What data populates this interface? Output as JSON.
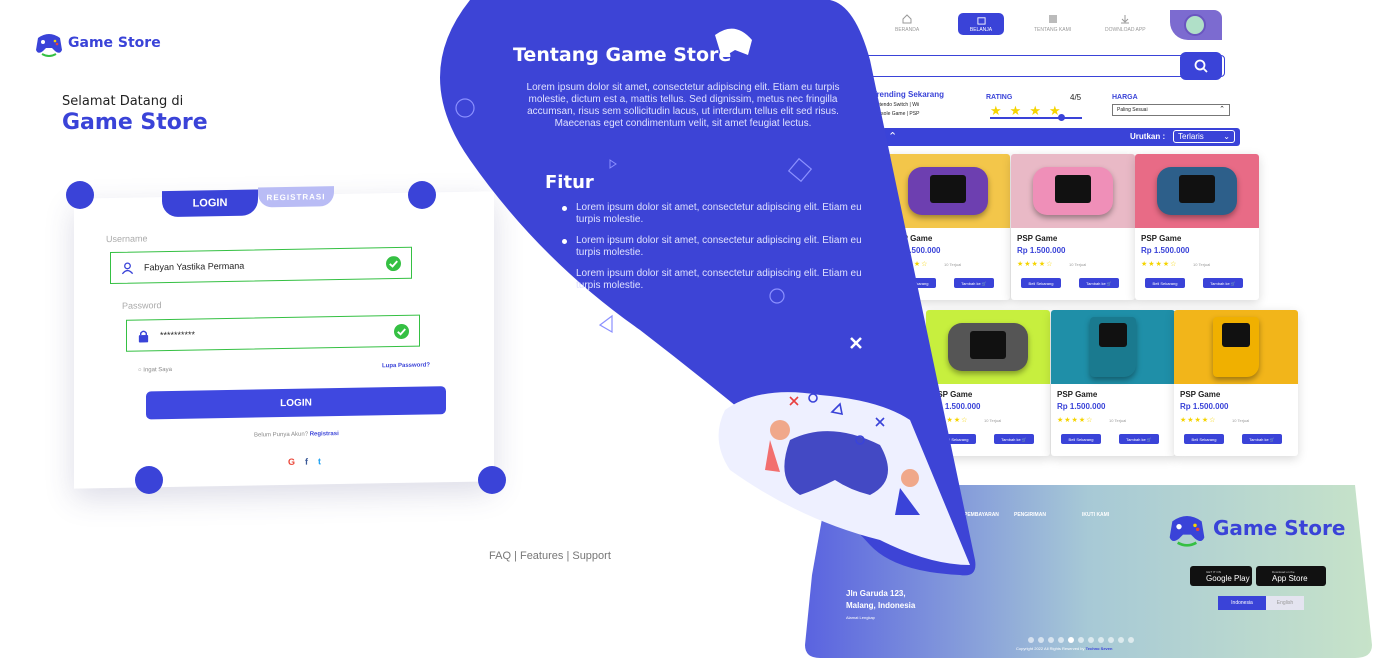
{
  "brand": "Game Store",
  "login": {
    "welcome": "Selamat Datang di",
    "welcome_brand": "Game Store",
    "tab_login": "LOGIN",
    "tab_register": "REGISTRASI",
    "username_label": "Username",
    "username_value": "Fabyan Yastika Permana",
    "password_label": "Password",
    "password_value": "**********",
    "remember": "Ingat Saya",
    "forgot": "Lupa Password?",
    "login_button": "LOGIN",
    "no_account": "Belum Punya Akun?",
    "register_link": "Registrasi",
    "social": [
      "G",
      "f",
      "t"
    ],
    "footer_links": "FAQ | Features | Support"
  },
  "about": {
    "title": "Tentang Game Store",
    "text": "Lorem ipsum dolor sit amet, consectetur adipiscing elit. Etiam eu turpis molestie, dictum est a, mattis tellus. Sed dignissim, metus nec fringilla accumsan, risus sem sollicitudin lacus, ut interdum tellus elit sed risus. Maecenas eget condimentum velit, sit amet feugiat lectus.",
    "features_title": "Fitur",
    "features": [
      "Lorem ipsum dolor sit amet, consectetur adipiscing elit. Etiam eu turpis molestie.",
      "Lorem ipsum dolor sit amet, consectetur adipiscing elit. Etiam eu turpis molestie.",
      "Lorem ipsum dolor sit amet, consectetur adipiscing elit. Etiam eu turpis molestie."
    ]
  },
  "shop": {
    "nav": [
      "BERANDA",
      "BELANJA",
      "TENTANG KAMI",
      "DOWNLOAD APP"
    ],
    "trending_title": "Trending Sekarang",
    "trending_items": [
      "Nintendo Switch | Wii",
      "Console Game | PSP"
    ],
    "rating_label": "RATING",
    "rating_value": "4/5",
    "rating_fraction": 0.8,
    "harga_label": "HARGA",
    "harga_value": "Paling Sesuai",
    "sort_label": "Urutkan :",
    "sort_value": "Terlaris",
    "products": [
      {
        "name": "PSP Game",
        "price": "Rp 1.500.000",
        "sold": "10 Terjual",
        "bg": "#f3c64a",
        "body": "#6d3fb0",
        "kind": "gba"
      },
      {
        "name": "PSP Game",
        "price": "Rp 1.500.000",
        "sold": "10 Terjual",
        "bg": "#e9b9c6",
        "body": "#ef8fb8",
        "kind": "psp"
      },
      {
        "name": "PSP Game",
        "price": "Rp 1.500.000",
        "sold": "10 Terjual",
        "bg": "#e86b86",
        "body": "#2d5f8a",
        "kind": "gba"
      },
      {
        "name": "PSP Game",
        "price": "Rp 1.500.000",
        "sold": "10 Terjual",
        "bg": "#c7ef3e",
        "body": "#555555",
        "kind": "gba"
      },
      {
        "name": "PSP Game",
        "price": "Rp 1.500.000",
        "sold": "10 Terjual",
        "bg": "#1f8fa8",
        "body": "#1a7a8f",
        "kind": "gb"
      },
      {
        "name": "PSP Game",
        "price": "Rp 1.500.000",
        "sold": "10 Terjual",
        "bg": "#f2b51a",
        "body": "#f0b000",
        "kind": "gb"
      }
    ],
    "buy_label": "Beli Sekarang",
    "cart_label": "Tambah ke",
    "stars": "★★★★☆"
  },
  "footer": {
    "col_pembayaran": "PEMBAYARAN",
    "col_pengiriman": "PENGIRIMAN",
    "col_ikuti": "IKUTI KAMI",
    "address_line1": "Jln Garuda 123,",
    "address_line2": "Malang, Indonesia",
    "address_sub": "Alamat Lengkap",
    "googleplay_small": "GET IT ON",
    "googleplay": "Google Play",
    "appstore_small": "Download on the",
    "appstore": "App Store",
    "lang_id": "Indonesia",
    "lang_en": "English",
    "copyright": "Copyright 2022 All Rights Reserved by",
    "copyright_brand": "Techno Seven"
  },
  "colors": {
    "primary": "#3a43d8",
    "success": "#35c043",
    "star": "#f5d400"
  }
}
